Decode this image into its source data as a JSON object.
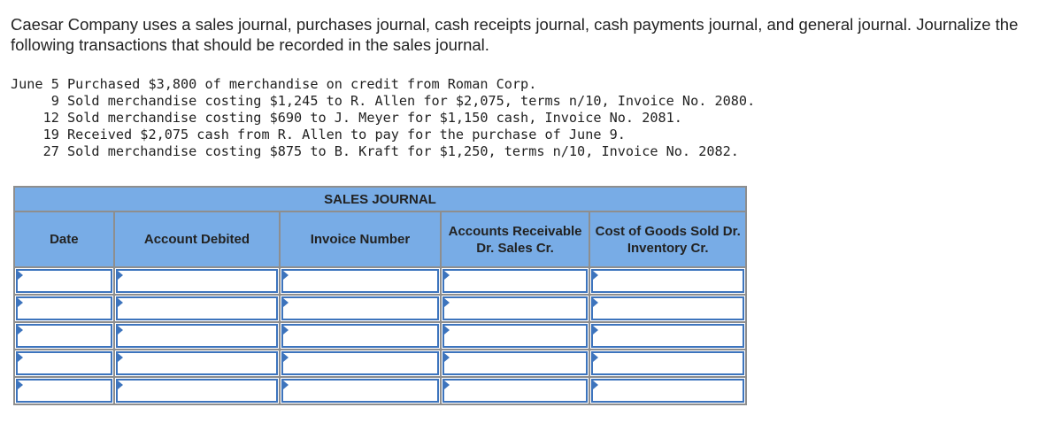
{
  "question": {
    "intro": "Caesar Company uses a sales journal, purchases journal, cash receipts journal, cash payments journal, and general journal. Journalize the following transactions that should be recorded in the sales journal.",
    "transactions": [
      "June 5 Purchased $3,800 of merchandise on credit from Roman Corp.",
      "     9 Sold merchandise costing $1,245 to R. Allen for $2,075, terms n/10, Invoice No. 2080.",
      "    12 Sold merchandise costing $690 to J. Meyer for $1,150 cash, Invoice No. 2081.",
      "    19 Received $2,075 cash from R. Allen to pay for the purchase of June 9.",
      "    27 Sold merchandise costing $875 to B. Kraft for $1,250, terms n/10, Invoice No. 2082."
    ]
  },
  "journal": {
    "title": "SALES JOURNAL",
    "columns": [
      "Date",
      "Account Debited",
      "Invoice Number",
      "Accounts Receivable Dr. Sales Cr.",
      "Cost of Goods Sold Dr. Inventory Cr."
    ],
    "rows": [
      [
        "",
        "",
        "",
        "",
        ""
      ],
      [
        "",
        "",
        "",
        "",
        ""
      ],
      [
        "",
        "",
        "",
        "",
        ""
      ],
      [
        "",
        "",
        "",
        "",
        ""
      ],
      [
        "",
        "",
        "",
        "",
        ""
      ]
    ]
  },
  "colors": {
    "header": "#78ace6",
    "input_border": "#3d74bd"
  }
}
